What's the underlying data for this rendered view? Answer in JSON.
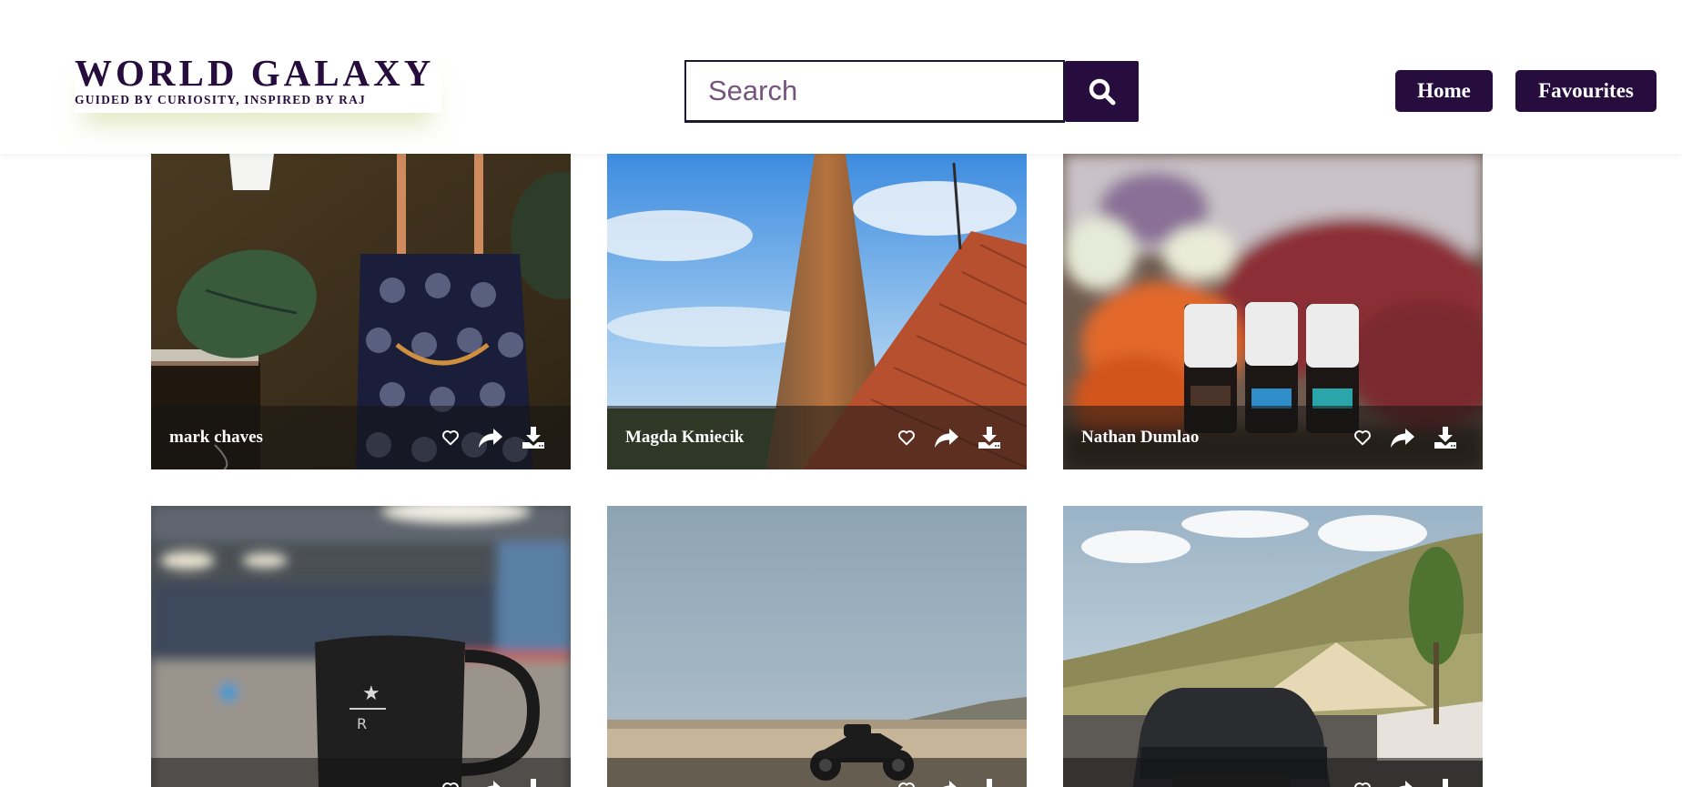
{
  "header": {
    "brand_title": "WORLD GALAXY",
    "brand_tagline": "GUIDED BY CURIOSITY, INSPIRED BY RAJ",
    "search_placeholder": "Search",
    "search_icon": "search-icon",
    "nav": [
      {
        "label": "Home"
      },
      {
        "label": "Favourites"
      }
    ],
    "brand_color": "#270d3e"
  },
  "gallery": {
    "action_icons": [
      "heart-icon",
      "share-icon",
      "download-icon"
    ],
    "cards": [
      {
        "author": "mark chaves",
        "subject": "bag-and-monstera-leaf-photo"
      },
      {
        "author": "Magda Kmiecik",
        "subject": "tiled-tower-and-roof-photo"
      },
      {
        "author": "Nathan Dumlao",
        "subject": "essential-oil-bottles-photo"
      },
      {
        "author": "",
        "subject": "coffee-mug-photo"
      },
      {
        "author": "",
        "subject": "motorcycle-in-field-photo"
      },
      {
        "author": "",
        "subject": "car-by-hillside-photo"
      }
    ]
  }
}
